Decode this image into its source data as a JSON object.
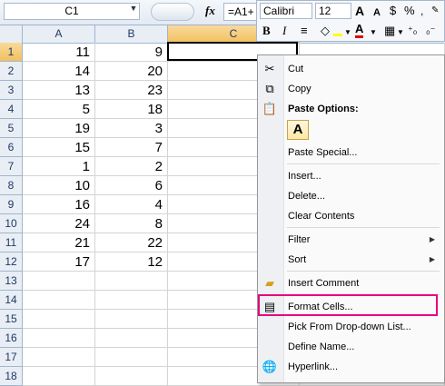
{
  "formula_bar": {
    "name_box": "C1",
    "name_box_arrow": "▼",
    "fx_label": "fx",
    "formula": "=A1+"
  },
  "columns": [
    "A",
    "B",
    "C"
  ],
  "rows": [
    {
      "num": "1",
      "a": "11",
      "b": "9"
    },
    {
      "num": "2",
      "a": "14",
      "b": "20"
    },
    {
      "num": "3",
      "a": "13",
      "b": "23"
    },
    {
      "num": "4",
      "a": "5",
      "b": "18"
    },
    {
      "num": "5",
      "a": "19",
      "b": "3"
    },
    {
      "num": "6",
      "a": "15",
      "b": "7"
    },
    {
      "num": "7",
      "a": "1",
      "b": "2"
    },
    {
      "num": "8",
      "a": "10",
      "b": "6"
    },
    {
      "num": "9",
      "a": "16",
      "b": "4"
    },
    {
      "num": "10",
      "a": "24",
      "b": "8"
    },
    {
      "num": "11",
      "a": "21",
      "b": "22"
    },
    {
      "num": "12",
      "a": "17",
      "b": "12"
    },
    {
      "num": "13",
      "a": "",
      "b": ""
    },
    {
      "num": "14",
      "a": "",
      "b": ""
    },
    {
      "num": "15",
      "a": "",
      "b": ""
    },
    {
      "num": "16",
      "a": "",
      "b": ""
    },
    {
      "num": "17",
      "a": "",
      "b": ""
    },
    {
      "num": "18",
      "a": "",
      "b": ""
    }
  ],
  "mini_toolbar": {
    "font_name": "Calibri",
    "font_size": "12",
    "grow_font": "A",
    "shrink_font": "A",
    "bold": "B",
    "italic": "I",
    "font_color": "A"
  },
  "context_menu": {
    "cut": "Cut",
    "copy": "Copy",
    "paste_options": "Paste Options:",
    "paste_a": "A",
    "paste_special": "Paste Special...",
    "insert": "Insert...",
    "delete": "Delete...",
    "clear_contents": "Clear Contents",
    "filter": "Filter",
    "sort": "Sort",
    "insert_comment": "Insert Comment",
    "format_cells": "Format Cells...",
    "pick_from_list": "Pick From Drop-down List...",
    "define_name": "Define Name...",
    "hyperlink": "Hyperlink...",
    "submenu_arrow": "▶"
  },
  "colors": {
    "highlight": "#e6007e",
    "selected_header": "#f1c15f",
    "header_bg": "#e9eef5"
  }
}
